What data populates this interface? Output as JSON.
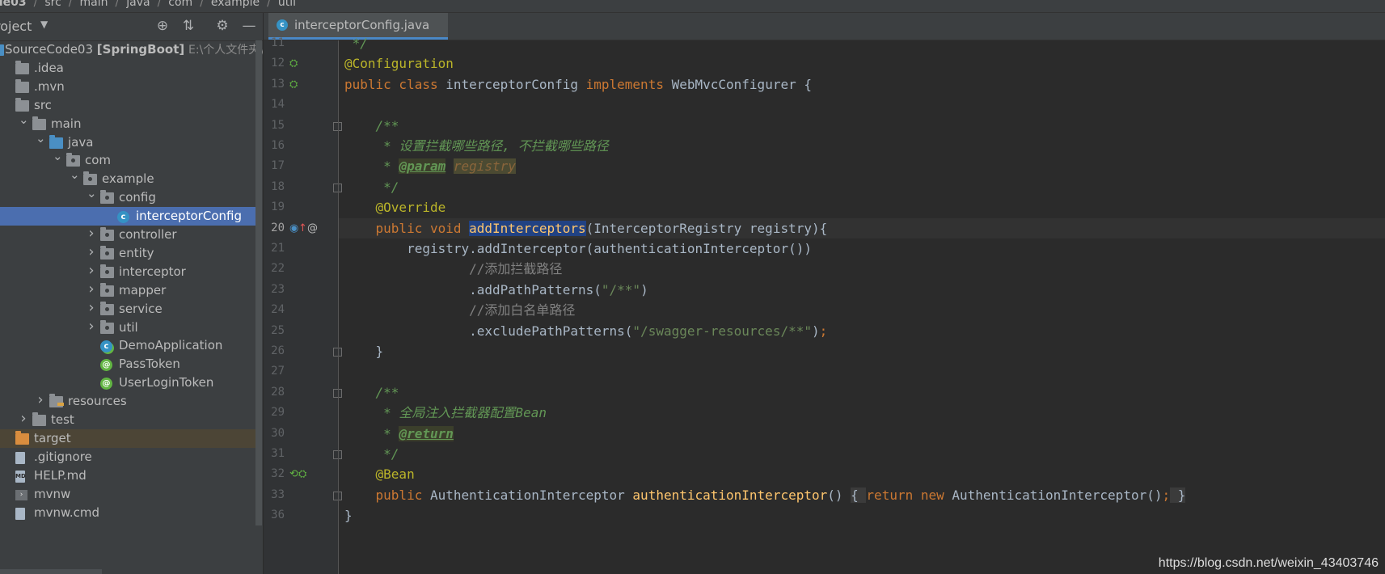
{
  "breadcrumb": [
    "ode03",
    "src",
    "main",
    "java",
    "com",
    "example",
    "util"
  ],
  "project_panel": {
    "title": "roject",
    "icons": [
      "locate-icon",
      "collapse-all-icon",
      "gear-icon",
      "minimize-icon"
    ]
  },
  "tree": [
    {
      "label": "SourceCode03",
      "bold_suffix": "[SpringBoot]",
      "path": "E:\\个人文件夹\\",
      "icon": "module-folder",
      "level": 0,
      "arrow": ""
    },
    {
      "label": ".idea",
      "icon": "folder",
      "level": 0,
      "arrow": ""
    },
    {
      "label": ".mvn",
      "icon": "folder",
      "level": 0,
      "arrow": ""
    },
    {
      "label": "src",
      "icon": "folder",
      "level": 0,
      "arrow": ""
    },
    {
      "label": "main",
      "icon": "folder",
      "level": 1,
      "arrow": "down"
    },
    {
      "label": "java",
      "icon": "folder-blue",
      "level": 2,
      "arrow": "down"
    },
    {
      "label": "com",
      "icon": "package",
      "level": 3,
      "arrow": "down"
    },
    {
      "label": "example",
      "icon": "package",
      "level": 4,
      "arrow": "down"
    },
    {
      "label": "config",
      "icon": "package",
      "level": 5,
      "arrow": "down"
    },
    {
      "label": "interceptorConfig",
      "icon": "class",
      "level": 6,
      "arrow": "",
      "selected": true
    },
    {
      "label": "controller",
      "icon": "package",
      "level": 5,
      "arrow": "right"
    },
    {
      "label": "entity",
      "icon": "package",
      "level": 5,
      "arrow": "right"
    },
    {
      "label": "interceptor",
      "icon": "package",
      "level": 5,
      "arrow": "right"
    },
    {
      "label": "mapper",
      "icon": "package",
      "level": 5,
      "arrow": "right"
    },
    {
      "label": "service",
      "icon": "package",
      "level": 5,
      "arrow": "right"
    },
    {
      "label": "util",
      "icon": "package",
      "level": 5,
      "arrow": "right"
    },
    {
      "label": "DemoApplication",
      "icon": "spring-class",
      "level": 5,
      "arrow": ""
    },
    {
      "label": "PassToken",
      "icon": "annotation",
      "level": 5,
      "arrow": ""
    },
    {
      "label": "UserLoginToken",
      "icon": "annotation",
      "level": 5,
      "arrow": ""
    },
    {
      "label": "resources",
      "icon": "folder-resources",
      "level": 2,
      "arrow": "right"
    },
    {
      "label": "test",
      "icon": "folder",
      "level": 1,
      "arrow": "right"
    },
    {
      "label": "target",
      "icon": "folder-orange",
      "level": 0,
      "arrow": "",
      "excluded": true
    },
    {
      "label": ".gitignore",
      "icon": "file",
      "level": 0,
      "arrow": ""
    },
    {
      "label": "HELP.md",
      "icon": "md-file",
      "level": 0,
      "arrow": ""
    },
    {
      "label": "mvnw",
      "icon": "terminal-file",
      "level": 0,
      "arrow": ""
    },
    {
      "label": "mvnw.cmd",
      "icon": "file",
      "level": 0,
      "arrow": ""
    }
  ],
  "editor": {
    "tab_label": "interceptorConfig.java",
    "current_line": 20,
    "lines": [
      {
        "n": "11",
        "tokens": [
          {
            "t": " */",
            "c": "doc"
          }
        ]
      },
      {
        "n": "12",
        "tokens": [
          {
            "t": "@Configuration",
            "c": "anno"
          }
        ]
      },
      {
        "n": "13",
        "tokens": [
          {
            "t": "public class ",
            "c": "kw"
          },
          {
            "t": "interceptorConfig ",
            "c": ""
          },
          {
            "t": "implements ",
            "c": "kw"
          },
          {
            "t": "WebMvcConfigurer {",
            "c": ""
          }
        ]
      },
      {
        "n": "14",
        "tokens": []
      },
      {
        "n": "15",
        "tokens": [
          {
            "t": "    /**",
            "c": "doc"
          }
        ]
      },
      {
        "n": "16",
        "tokens": [
          {
            "t": "     * 设置拦截哪些路径, 不拦截哪些路径",
            "c": "doc"
          }
        ]
      },
      {
        "n": "17",
        "tokens": [
          {
            "t": "     * ",
            "c": "doc"
          },
          {
            "t": "@param",
            "c": "doctag"
          },
          {
            "t": " ",
            "c": "doc"
          },
          {
            "t": "registry",
            "c": "docparam"
          }
        ]
      },
      {
        "n": "18",
        "tokens": [
          {
            "t": "     */",
            "c": "doc"
          }
        ]
      },
      {
        "n": "19",
        "tokens": [
          {
            "t": "    @Override",
            "c": "anno"
          }
        ]
      },
      {
        "n": "20",
        "tokens": [
          {
            "t": "    public void ",
            "c": "kw"
          },
          {
            "t": "addInterceptors",
            "c": "fn hl"
          },
          {
            "t": "(InterceptorRegistry registry){",
            "c": ""
          }
        ]
      },
      {
        "n": "21",
        "tokens": [
          {
            "t": "        registry.addInterceptor(authenticationInterceptor())",
            "c": ""
          }
        ]
      },
      {
        "n": "22",
        "tokens": [
          {
            "t": "                //添加拦截路径",
            "c": "cmt"
          }
        ]
      },
      {
        "n": "23",
        "tokens": [
          {
            "t": "                .addPathPatterns(",
            "c": ""
          },
          {
            "t": "\"/**\"",
            "c": "str"
          },
          {
            "t": ")",
            "c": ""
          }
        ]
      },
      {
        "n": "24",
        "tokens": [
          {
            "t": "                //添加白名单路径",
            "c": "cmt"
          }
        ]
      },
      {
        "n": "25",
        "tokens": [
          {
            "t": "                .excludePathPatterns(",
            "c": ""
          },
          {
            "t": "\"/swagger-resources/**\"",
            "c": "str"
          },
          {
            "t": ")",
            "c": ""
          },
          {
            "t": ";",
            "c": "kw"
          }
        ]
      },
      {
        "n": "26",
        "tokens": [
          {
            "t": "    }",
            "c": ""
          }
        ]
      },
      {
        "n": "27",
        "tokens": []
      },
      {
        "n": "28",
        "tokens": [
          {
            "t": "    /**",
            "c": "doc"
          }
        ]
      },
      {
        "n": "29",
        "tokens": [
          {
            "t": "     * 全局注入拦截器配置Bean",
            "c": "doc"
          }
        ]
      },
      {
        "n": "30",
        "tokens": [
          {
            "t": "     * ",
            "c": "doc"
          },
          {
            "t": "@return",
            "c": "doctag"
          }
        ]
      },
      {
        "n": "31",
        "tokens": [
          {
            "t": "     */",
            "c": "doc"
          }
        ]
      },
      {
        "n": "32",
        "tokens": [
          {
            "t": "    @Bean",
            "c": "anno"
          }
        ]
      },
      {
        "n": "33",
        "tokens": [
          {
            "t": "    public ",
            "c": "kw"
          },
          {
            "t": "AuthenticationInterceptor ",
            "c": ""
          },
          {
            "t": "authenticationInterceptor",
            "c": "fn"
          },
          {
            "t": "() ",
            "c": ""
          },
          {
            "t": "{ ",
            "c": "fold-box"
          },
          {
            "t": "return new ",
            "c": "kw"
          },
          {
            "t": "AuthenticationInterceptor()",
            "c": ""
          },
          {
            "t": ";",
            "c": "kw"
          },
          {
            "t": " }",
            "c": "fold-box"
          }
        ]
      },
      {
        "n": "36",
        "tokens": [
          {
            "t": "}",
            "c": ""
          }
        ]
      }
    ]
  },
  "watermark": "https://blog.csdn.net/weixin_43403746"
}
